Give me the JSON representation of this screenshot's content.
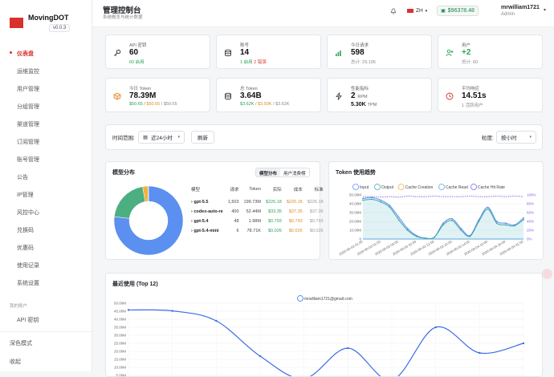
{
  "brand": {
    "name": "MovingDOT",
    "version": "v0.0.3"
  },
  "nav": {
    "items": [
      {
        "label": "仪表盘",
        "active": true
      },
      {
        "label": "运维监控"
      },
      {
        "label": "用户管理"
      },
      {
        "label": "分组管理"
      },
      {
        "label": "渠道管理"
      },
      {
        "label": "订阅管理"
      },
      {
        "label": "账号管理"
      },
      {
        "label": "公告"
      },
      {
        "label": "IP管理"
      },
      {
        "label": "风控中心"
      },
      {
        "label": "兑换码"
      },
      {
        "label": "优惠码"
      },
      {
        "label": "使用记录"
      },
      {
        "label": "系统设置"
      }
    ],
    "my_account_label": "我的账户",
    "api_keys_label": "API 密钥",
    "dark_mode_label": "深色模式",
    "collapse_label": "收起"
  },
  "header": {
    "title": "管理控制台",
    "subtitle": "系统概览与统计数据",
    "language": "ZH",
    "balance": "$96378.48",
    "username": "mrwilliam1721",
    "role": "Admin"
  },
  "stats_row1": [
    {
      "label": "API 密钥",
      "value": "60",
      "sub": "60 启用",
      "sub_color": "green",
      "icon": "key-icon"
    },
    {
      "label": "账号",
      "value": "14",
      "sub_a": "1 启用",
      "sub_b": "2 错误",
      "icon": "database-icon"
    },
    {
      "label": "今日请求",
      "value": "598",
      "sub": "总计: 29,195",
      "sub_color": "grey",
      "icon": "bar-chart-icon"
    },
    {
      "label": "用户",
      "value": "+2",
      "sub": "总计: 60",
      "sub_color": "grey",
      "icon": "user-plus-icon"
    }
  ],
  "stats_row2": [
    {
      "label": "今日 Token",
      "value": "78.39M",
      "sub_a": "$50.65",
      "sub_b": "$50.65",
      "sub_c": "$50.65",
      "icon": "cube-icon"
    },
    {
      "label": "总 Token",
      "value": "3.64B",
      "sub_a": "$3.62K",
      "sub_b": "$3.50K",
      "sub_c": "$3.62K",
      "icon": "database-icon"
    },
    {
      "label": "性能指标",
      "value": "2",
      "value_unit": "RPM",
      "value2": "5.30K",
      "value2_unit": "TPM",
      "icon": "lightning-icon"
    },
    {
      "label": "平均响应",
      "value": "14.51s",
      "sub": "1 活跃用户",
      "sub_color": "grey",
      "icon": "clock-icon"
    }
  ],
  "filters": {
    "time_range_label": "时间范围:",
    "time_range_value": "近24小时",
    "refresh_label": "刷新",
    "granularity_label": "粒度:",
    "granularity_value": "按小时"
  },
  "model_dist": {
    "title": "模型分布",
    "tabs": [
      "模型分布",
      "用户消费榜"
    ],
    "columns": [
      "模型",
      "请求",
      "Token",
      "实际",
      "成本",
      "标准"
    ],
    "rows": [
      {
        "model": "gpt-5.5",
        "requests": "1,503",
        "tokens": "199.73M",
        "actual": "$226.18",
        "cost": "$226.18",
        "standard": "$226.18"
      },
      {
        "model": "codex-auto-re",
        "requests": "400",
        "tokens": "52.44M",
        "actual": "$33.35",
        "cost": "$37.35",
        "standard": "$37.35"
      },
      {
        "model": "gpt-5.4",
        "requests": "48",
        "tokens": "1.98M",
        "actual": "$0.793",
        "cost": "$0.793",
        "standard": "$0.793"
      },
      {
        "model": "gpt-5.4-mini",
        "requests": "6",
        "tokens": "78.71K",
        "actual": "$0.026",
        "cost": "$0.026",
        "standard": "$0.026"
      }
    ]
  },
  "chart_data": [
    {
      "type": "pie",
      "subtype": "donut",
      "categories": [
        "gpt-5.5",
        "codex-auto-re",
        "gpt-5.4",
        "gpt-5.4-mini"
      ],
      "values": [
        1503,
        400,
        48,
        6
      ],
      "colors": [
        "#5b8ff0",
        "#4caf82",
        "#f2b33d",
        "#e06666"
      ]
    },
    {
      "type": "line",
      "title": "Token 使用趋势",
      "x": [
        "2026-06-03 01:00",
        "2026-06-03 01:00",
        "2026-06-03 01:00",
        "2026-06-03 03:00",
        "2026-06-03 03:00",
        "2026-06-03 02:00",
        "2026-06-03 02:00",
        "2026-06-03 06:00",
        "2026-06-03 12:00",
        "2026-06-03 12:00",
        "2026-06-03 10:00",
        "2026-06-03 12:00",
        "2026-06-03 14:00",
        "2026-06-04 06:00",
        "2026-06-04 10:00",
        "2026-06-04 18:00",
        "2026-06-04 20:00",
        "2026-06-04 21:00",
        "2026-06-04 01:00"
      ],
      "x_tick_labels": [
        "2026-06-03 01:00",
        "2026-06-03 01:00",
        "2026-06-03 01:00",
        "2026-06-03 03:00",
        "2026-06-03 03:00",
        "2026-06-03 02:00",
        "2026-06-03 02:00",
        "2026-06-03 06:00",
        "2026-06-03 12:00",
        "2026-06-03 12:00",
        "2026-06-03 10:00",
        "2026-06-03 12:00",
        "2026-06-03 14:00",
        "2026-06-04 06:00",
        "2026-06-04 10:00",
        "2026-06-04 18:00",
        "2026-06-04 20:00",
        "2026-06-04 21:00",
        "2026-06-04 01:00"
      ],
      "series": [
        {
          "name": "Input",
          "color": "#5b8ff0",
          "values": [
            46000000,
            47000000,
            44000000,
            38000000,
            25000000,
            12000000,
            4000000,
            1000000,
            2000000,
            18000000,
            23000000,
            12000000,
            4000000,
            22000000,
            36000000,
            20000000,
            18000000,
            16000000,
            24000000
          ]
        },
        {
          "name": "Output",
          "color": "#3fa8a8",
          "values": [
            44000000,
            45000000,
            42000000,
            36000000,
            22000000,
            10000000,
            3000000,
            1000000,
            2000000,
            16000000,
            21000000,
            10000000,
            3000000,
            20000000,
            34000000,
            18000000,
            16000000,
            15000000,
            22000000
          ]
        },
        {
          "name": "Cache Creation",
          "color": "#f2b33d",
          "values": [
            0,
            0,
            0,
            0,
            0,
            0,
            0,
            0,
            0,
            0,
            0,
            0,
            0,
            0,
            0,
            0,
            0,
            0,
            0
          ]
        },
        {
          "name": "Cache Read",
          "color": "#5aa5d6",
          "values": [
            0,
            0,
            0,
            0,
            0,
            0,
            0,
            0,
            0,
            0,
            0,
            0,
            0,
            0,
            0,
            0,
            0,
            0,
            0
          ]
        },
        {
          "name": "Cache Hit Rate",
          "color": "#8a5cf0",
          "axis": "right",
          "values": [
            96,
            96,
            95,
            96,
            95,
            97,
            96,
            96,
            97,
            96,
            96,
            96,
            97,
            96,
            96,
            97,
            96,
            97,
            96
          ]
        }
      ],
      "y_ticks": [
        "50.00M",
        "40.00M",
        "30.00M",
        "20.00M",
        "10.00M",
        "0"
      ],
      "y2_ticks": [
        "100%",
        "80%",
        "60%",
        "40%",
        "20%",
        "0%"
      ],
      "ylim": [
        0,
        50000000
      ],
      "y2lim": [
        0,
        100
      ]
    },
    {
      "type": "line",
      "title": "最近使用 (Top 12)",
      "series": [
        {
          "name": "mrwilliam1721@gmail.com",
          "color": "#3b6ee6",
          "values": [
            45800000,
            45200000,
            39000000,
            17000000,
            3000000,
            22000000,
            2000000,
            35000000,
            19000000,
            25000000
          ]
        }
      ],
      "y_ticks": [
        "50.00M",
        "45.00M",
        "40.00M",
        "35.00M",
        "30.00M",
        "25.00M",
        "20.00M",
        "15.00M",
        "10.00M",
        "5.00M"
      ],
      "ylim": [
        0,
        50000000
      ]
    }
  ]
}
